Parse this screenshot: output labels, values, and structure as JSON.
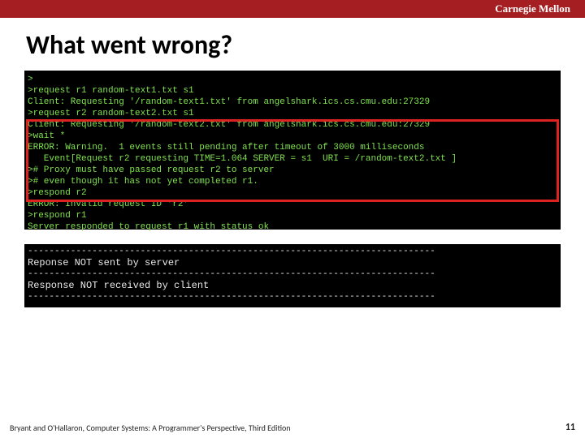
{
  "topbar": {
    "brand": "Carnegie Mellon"
  },
  "title": "What went wrong?",
  "terminal1": {
    "lines": [
      ">",
      ">request r1 random-text1.txt s1",
      "Client: Requesting '/random-text1.txt' from angelshark.ics.cs.cmu.edu:27329",
      ">request r2 random-text2.txt s1",
      "Client: Requesting '/random-text2.txt' from angelshark.ics.cs.cmu.edu:27329",
      ">wait *",
      "ERROR: Warning.  1 events still pending after timeout of 3000 milliseconds",
      "   Event[Request r2 requesting TIME=1.064 SERVER = s1  URI = /random-text2.txt ]",
      "># Proxy must have passed request r2 to server",
      "># even though it has not yet completed r1.",
      ">respond r2",
      "ERROR: Invalid request ID 'r2'",
      ">respond r1",
      "Server responded to request r1 with status ok"
    ]
  },
  "terminal2": {
    "dash": "----------------------------------------------------------------------------",
    "label1": "Reponse NOT sent by server",
    "label2": "Response NOT received by client"
  },
  "footer": {
    "left": "Bryant and O'Hallaron, Computer Systems: A Programmer's Perspective, Third Edition",
    "right": "11"
  }
}
